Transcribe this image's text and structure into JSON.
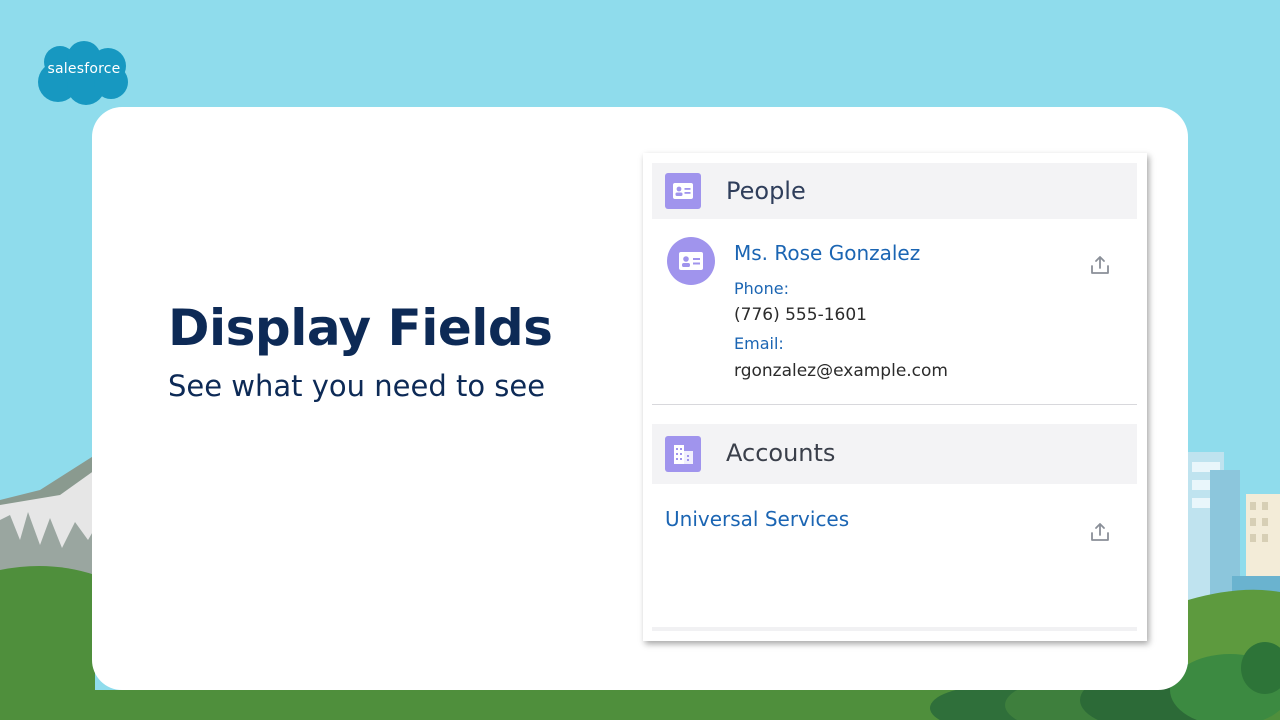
{
  "brand": {
    "logo_text": "salesforce"
  },
  "hero": {
    "title": "Display Fields",
    "subtitle": "See what you need to see"
  },
  "panel": {
    "people": {
      "title": "People",
      "contact": {
        "name": "Ms. Rose Gonzalez",
        "phone_label": "Phone:",
        "phone": "(776) 555-1601",
        "email_label": "Email:",
        "email": "rgonzalez@example.com"
      }
    },
    "accounts": {
      "title": "Accounts",
      "items": [
        {
          "name": "Universal Services"
        }
      ]
    }
  },
  "colors": {
    "sky": "#8fdcec",
    "title_navy": "#0d2a56",
    "link_blue": "#1b65b3",
    "icon_purple": "#a094ed"
  }
}
